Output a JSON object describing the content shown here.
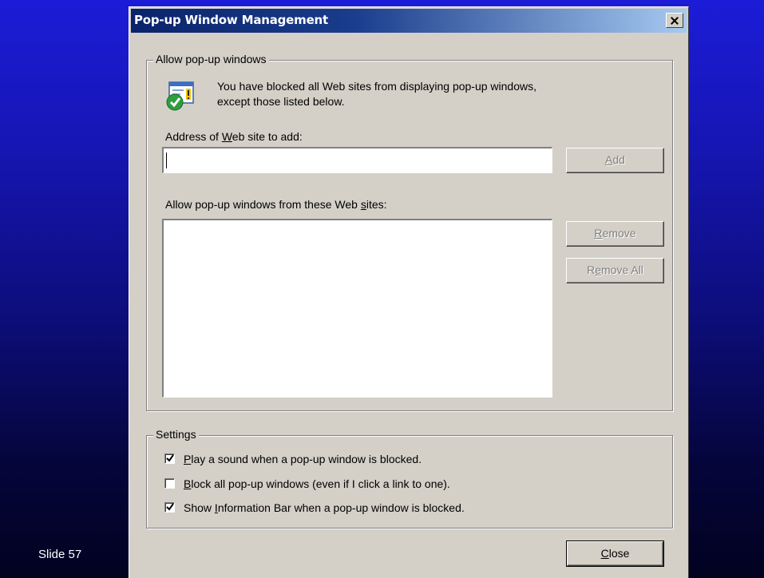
{
  "slide": {
    "label": "Slide 57"
  },
  "dialog": {
    "title": "Pop-up Window Management",
    "allow_group": {
      "title": "Allow pop-up windows",
      "info_line1": "You have blocked all Web sites from displaying pop-up windows,",
      "info_line2": "except those listed below.",
      "address_label_pre": "Address of ",
      "address_label_key": "W",
      "address_label_post": "eb site to add:",
      "address_value": "",
      "add_button_key": "A",
      "add_button_rest": "dd",
      "list_label_pre": "Allow pop-up windows from these Web ",
      "list_label_key": "s",
      "list_label_post": "ites:",
      "sites": [],
      "remove_button_key": "R",
      "remove_button_rest": "emove",
      "remove_all_pre": "R",
      "remove_all_key": "e",
      "remove_all_post": "move All"
    },
    "settings_group": {
      "title": "Settings",
      "options": [
        {
          "pre": "",
          "key": "P",
          "post": "lay a sound when a pop-up window is blocked.",
          "checked": true
        },
        {
          "pre": "",
          "key": "B",
          "post": "lock all pop-up windows (even if I click a link to one).",
          "checked": false
        },
        {
          "pre": "Show ",
          "key": "I",
          "post": "nformation Bar when a pop-up window is blocked.",
          "checked": true
        }
      ]
    },
    "close_button_key": "C",
    "close_button_rest": "lose"
  },
  "icons": {
    "title_close": "close-icon",
    "info": "popup-info-shield-icon",
    "check": "checkmark-icon"
  },
  "colors": {
    "title_bar_start": "#0a246a",
    "title_bar_end": "#a6caf0",
    "dialog_face": "#d4d0c8",
    "background_top": "#1c1cd8",
    "background_bottom": "#020220"
  }
}
